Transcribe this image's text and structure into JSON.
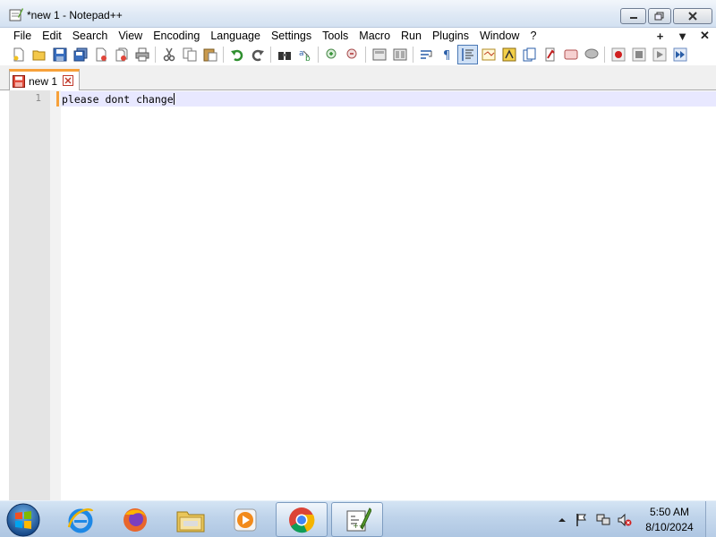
{
  "window": {
    "title": "*new 1 - Notepad++"
  },
  "menu": {
    "items": [
      "File",
      "Edit",
      "Search",
      "View",
      "Encoding",
      "Language",
      "Settings",
      "Tools",
      "Macro",
      "Run",
      "Plugins",
      "Window",
      "?"
    ],
    "right": [
      "+",
      "▼",
      "✕"
    ]
  },
  "toolbar": {
    "icons": [
      "new-file-icon",
      "open-file-icon",
      "save-icon",
      "save-all-icon",
      "close-icon",
      "close-all-icon",
      "print-icon",
      "cut-icon",
      "copy-icon",
      "paste-icon",
      "undo-icon",
      "redo-icon",
      "find-icon",
      "replace-icon",
      "zoom-in-icon",
      "zoom-out-icon",
      "sync-vertical-icon",
      "sync-horizontal-icon",
      "word-wrap-icon",
      "show-all-chars-icon",
      "indent-guide-icon",
      "udl-icon",
      "doc-map-icon",
      "function-list-icon",
      "folder-workspace-icon",
      "monitoring-icon",
      "record-macro-icon",
      "stop-macro-icon",
      "play-macro-icon",
      "run-macro-multiple-icon"
    ],
    "pressed": "indent-guide-icon"
  },
  "tabs": [
    {
      "label": "new 1",
      "unsaved": true
    }
  ],
  "editor": {
    "lines": [
      {
        "number": "1",
        "text": "please dont change"
      }
    ]
  },
  "taskbar": {
    "apps": [
      "internet-explorer-icon",
      "firefox-icon",
      "file-explorer-icon",
      "media-player-icon",
      "chrome-icon",
      "notepadpp-icon"
    ],
    "active": "notepadpp-icon",
    "time": "5:50 AM",
    "date": "8/10/2024"
  },
  "colors": {
    "accent_tab": "#f7a13a",
    "current_line": "#e8e8ff",
    "gutter": "#e4e4e4"
  }
}
